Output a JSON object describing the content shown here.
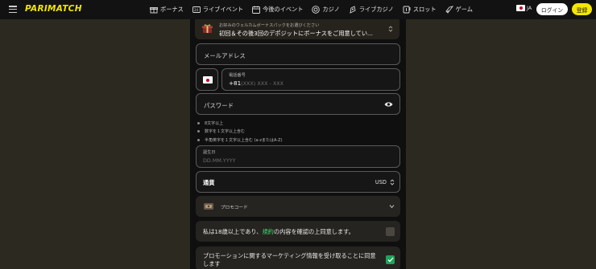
{
  "header": {
    "logo": "PARIMATCH",
    "nav": [
      {
        "label": "ボーナス",
        "icon": "gift-icon"
      },
      {
        "label": "ライブイベント",
        "icon": "live-icon"
      },
      {
        "label": "今後のイベント",
        "icon": "calendar-icon"
      },
      {
        "label": "カジノ",
        "icon": "casino-chip-icon"
      },
      {
        "label": "ライブカジノ",
        "icon": "live-casino-icon"
      },
      {
        "label": "スロット",
        "icon": "slot-icon"
      },
      {
        "label": "ゲーム",
        "icon": "rocket-icon"
      }
    ],
    "language": "JA",
    "login_label": "ログイン",
    "register_label": "登録"
  },
  "form": {
    "bonus": {
      "label": "お好みのウェルカムボーナスパックをお選びください",
      "value": "初回＆その後3回のデポジットにボーナスをご用意してい..."
    },
    "email_placeholder": "メールアドレス",
    "phone": {
      "label": "電話番号",
      "code": "+81",
      "placeholder": "(XXX) XXX - XXX"
    },
    "password_placeholder": "パスワード",
    "password_rules": [
      "8文字以上",
      "数字を１文字以上含む",
      "半角英字を１文字以上含む (a-zまたはA-Z)"
    ],
    "birthdate": {
      "label": "誕生日",
      "placeholder": "DD.MM.YYYY"
    },
    "currency": {
      "label": "通貨",
      "value": "USD"
    },
    "promo_label": "プロモコード",
    "age_consent": {
      "before": "私は18歳以上であり、",
      "link": "規約",
      "after": "の内容を確認の上同意します。",
      "checked": false
    },
    "marketing_consent": {
      "text": "プロモーションに関するマーケティング情報を受け取ることに同意します",
      "checked": true
    }
  },
  "colors": {
    "brand_yellow": "#f3e600",
    "link_green": "#3fd36b",
    "checkbox_green": "#1fa35a"
  }
}
